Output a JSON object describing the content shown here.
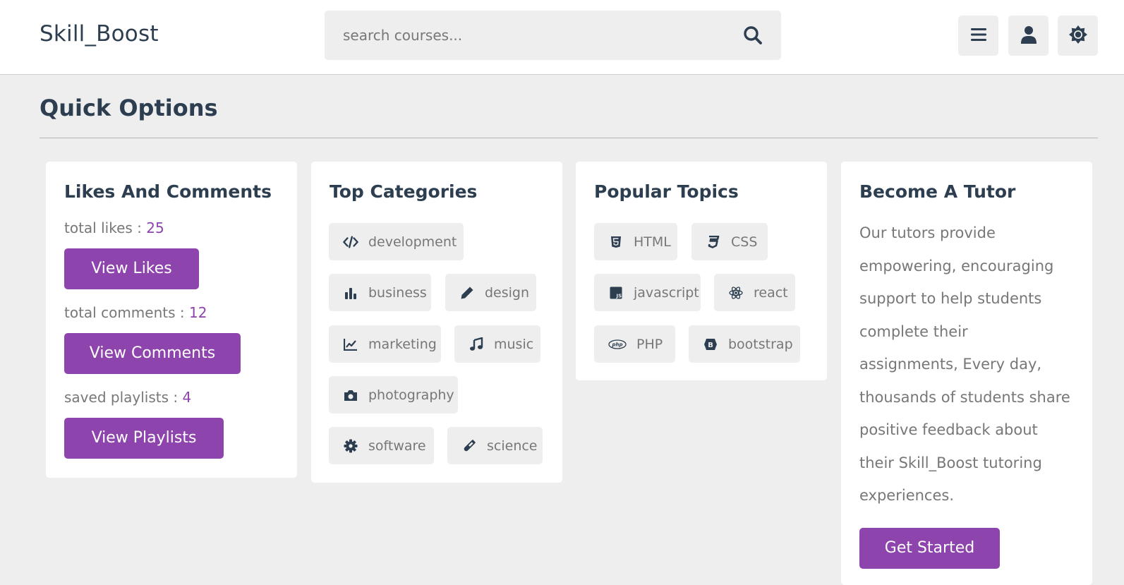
{
  "header": {
    "logo": "Skill_Boost",
    "search_placeholder": "search courses...",
    "icons": [
      "search-icon",
      "menu-icon",
      "user-icon",
      "sun-icon"
    ]
  },
  "section": {
    "title": "Quick Options"
  },
  "likes_card": {
    "title": "Likes And Comments",
    "likes_label": "total likes : ",
    "likes_value": "25",
    "likes_button": "View Likes",
    "comments_label": "total comments : ",
    "comments_value": "12",
    "comments_button": "View Comments",
    "playlists_label": "saved playlists : ",
    "playlists_value": "4",
    "playlists_button": "View Playlists"
  },
  "categories_card": {
    "title": "Top Categories",
    "items": [
      {
        "label": "development",
        "icon": "code-icon"
      },
      {
        "label": "business",
        "icon": "bar-chart-icon"
      },
      {
        "label": "design",
        "icon": "pencil-icon"
      },
      {
        "label": "marketing",
        "icon": "line-chart-icon"
      },
      {
        "label": "music",
        "icon": "music-icon"
      },
      {
        "label": "photography",
        "icon": "camera-icon"
      },
      {
        "label": "software",
        "icon": "gear-icon"
      },
      {
        "label": "science",
        "icon": "vial-icon"
      }
    ]
  },
  "topics_card": {
    "title": "Popular Topics",
    "items": [
      {
        "label": "HTML",
        "icon": "html5-icon"
      },
      {
        "label": "CSS",
        "icon": "css3-icon"
      },
      {
        "label": "javascript",
        "icon": "js-icon"
      },
      {
        "label": "react",
        "icon": "react-icon"
      },
      {
        "label": "PHP",
        "icon": "php-icon"
      },
      {
        "label": "bootstrap",
        "icon": "bootstrap-icon"
      }
    ]
  },
  "tutor_card": {
    "title": "Become A Tutor",
    "text": "Our tutors provide empowering, encouraging support to help students complete their assignments, Every day, thousands of students share positive feedback about their Skill_Boost tutoring experiences.",
    "button": "Get Started"
  },
  "colors": {
    "accent": "#8e44ad",
    "heading": "#2c3e50",
    "muted": "#777777",
    "background": "#eeeeee"
  }
}
